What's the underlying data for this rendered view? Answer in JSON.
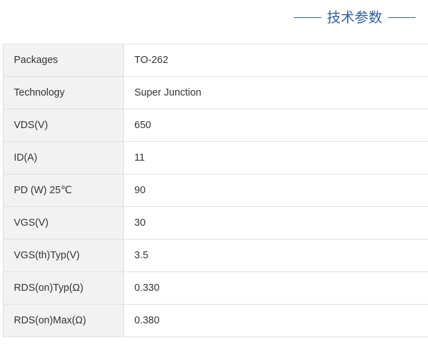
{
  "header": {
    "title": "技术参数"
  },
  "specs": [
    {
      "label": "Packages",
      "value": "TO-262"
    },
    {
      "label": "Technology",
      "value": "Super Junction"
    },
    {
      "label": "VDS(V)",
      "value": "650"
    },
    {
      "label": "ID(A)",
      "value": "11"
    },
    {
      "label": "PD (W) 25℃",
      "value": "90"
    },
    {
      "label": "VGS(V)",
      "value": "30"
    },
    {
      "label": "VGS(th)Typ(V)",
      "value": "3.5"
    },
    {
      "label": "RDS(on)Typ(Ω)",
      "value": "0.330"
    },
    {
      "label": "RDS(on)Max(Ω)",
      "value": "0.380"
    }
  ],
  "colors": {
    "accent": "#2e5fa8",
    "label_bg": "#f2f2f2",
    "border": "#e1e1e1",
    "text": "#333333"
  }
}
